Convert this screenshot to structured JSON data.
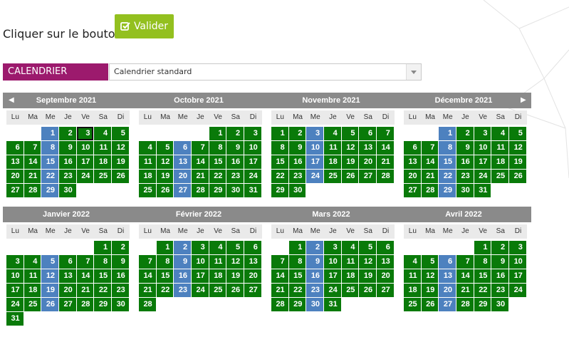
{
  "instruction": {
    "text": "Cliquer sur le bouton"
  },
  "valider": {
    "label": "Valider"
  },
  "calendar_bar": {
    "label": "CALENDRIER",
    "selected": "Calendrier standard"
  },
  "nav": {
    "prev": "◀",
    "next": "▶"
  },
  "weekdays": [
    "Lu",
    "Ma",
    "Me",
    "Je",
    "Ve",
    "Sa",
    "Di"
  ],
  "months": [
    {
      "name": "Septembre 2021",
      "offset": 2,
      "days": 30,
      "blue": [
        1,
        8,
        15,
        22,
        29
      ],
      "today": 3
    },
    {
      "name": "Octobre 2021",
      "offset": 4,
      "days": 31,
      "blue": [
        6,
        13,
        20,
        27
      ],
      "today": null
    },
    {
      "name": "Novembre 2021",
      "offset": 0,
      "days": 30,
      "blue": [
        3,
        10,
        17,
        24
      ],
      "today": null
    },
    {
      "name": "Décembre 2021",
      "offset": 2,
      "days": 31,
      "blue": [
        1,
        8,
        15,
        22,
        29
      ],
      "today": null
    },
    {
      "name": "Janvier 2022",
      "offset": 5,
      "days": 31,
      "blue": [
        5,
        12,
        19,
        26
      ],
      "today": null
    },
    {
      "name": "Février 2022",
      "offset": 1,
      "days": 28,
      "blue": [
        2,
        9,
        16,
        23
      ],
      "today": null
    },
    {
      "name": "Mars 2022",
      "offset": 1,
      "days": 31,
      "blue": [
        2,
        9,
        16,
        23,
        30
      ],
      "today": null
    },
    {
      "name": "Avril 2022",
      "offset": 4,
      "days": 30,
      "blue": [
        6,
        13,
        20,
        27
      ],
      "today": null
    }
  ],
  "colors": {
    "brand": "#9c1a6d",
    "valider": "#93c01f",
    "day_green": "#097a09",
    "day_blue": "#4d81bf",
    "header_gray": "#8a8a8a"
  }
}
